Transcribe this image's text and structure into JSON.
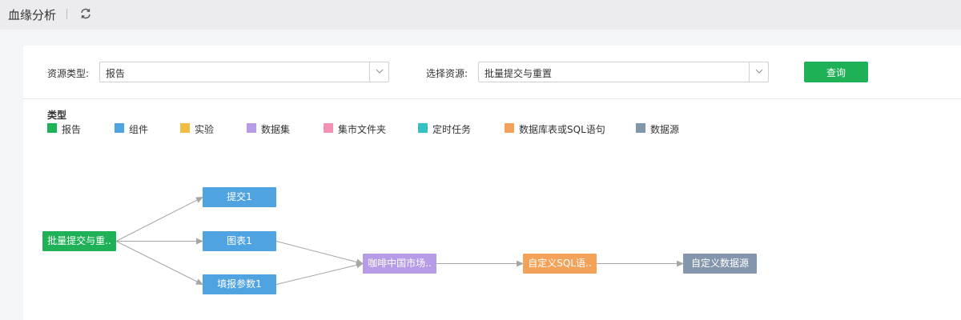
{
  "header": {
    "title": "血缘分析",
    "refresh_icon": "refresh-icon"
  },
  "filters": {
    "resource_type_label": "资源类型:",
    "resource_type_value": "报告",
    "resource_label": "选择资源:",
    "resource_value": "批量提交与重置",
    "query_label": "查询"
  },
  "legend": {
    "title": "类型",
    "items": [
      {
        "label": "报告",
        "color": "#1fb158"
      },
      {
        "label": "组件",
        "color": "#4fa3e0"
      },
      {
        "label": "实验",
        "color": "#f0bc41"
      },
      {
        "label": "数据集",
        "color": "#b69be6"
      },
      {
        "label": "集市文件夹",
        "color": "#f591b6"
      },
      {
        "label": "定时任务",
        "color": "#35c0c2"
      },
      {
        "label": "数据库表或SQL语句",
        "color": "#f4a259"
      },
      {
        "label": "数据源",
        "color": "#8496ad"
      }
    ]
  },
  "graph": {
    "edge_color": "#a6a6a6",
    "nodes": [
      {
        "id": "report",
        "label": "批量提交与重..",
        "type": "报告",
        "color": "#1fb158"
      },
      {
        "id": "submit1",
        "label": "提交1",
        "type": "组件",
        "color": "#4fa3e0"
      },
      {
        "id": "chart1",
        "label": "图表1",
        "type": "组件",
        "color": "#4fa3e0"
      },
      {
        "id": "param1",
        "label": "填报参数1",
        "type": "组件",
        "color": "#4fa3e0"
      },
      {
        "id": "dataset",
        "label": "咖啡中国市场..",
        "type": "数据集",
        "color": "#b69be6"
      },
      {
        "id": "sql",
        "label": "自定义SQL语..",
        "type": "数据库表或SQL语句",
        "color": "#f4a259"
      },
      {
        "id": "datasource",
        "label": "自定义数据源",
        "type": "数据源",
        "color": "#8496ad"
      }
    ],
    "edges": [
      {
        "from": "report",
        "to": "submit1"
      },
      {
        "from": "report",
        "to": "chart1"
      },
      {
        "from": "report",
        "to": "param1"
      },
      {
        "from": "chart1",
        "to": "dataset"
      },
      {
        "from": "param1",
        "to": "dataset"
      },
      {
        "from": "dataset",
        "to": "sql"
      },
      {
        "from": "sql",
        "to": "datasource"
      }
    ]
  }
}
